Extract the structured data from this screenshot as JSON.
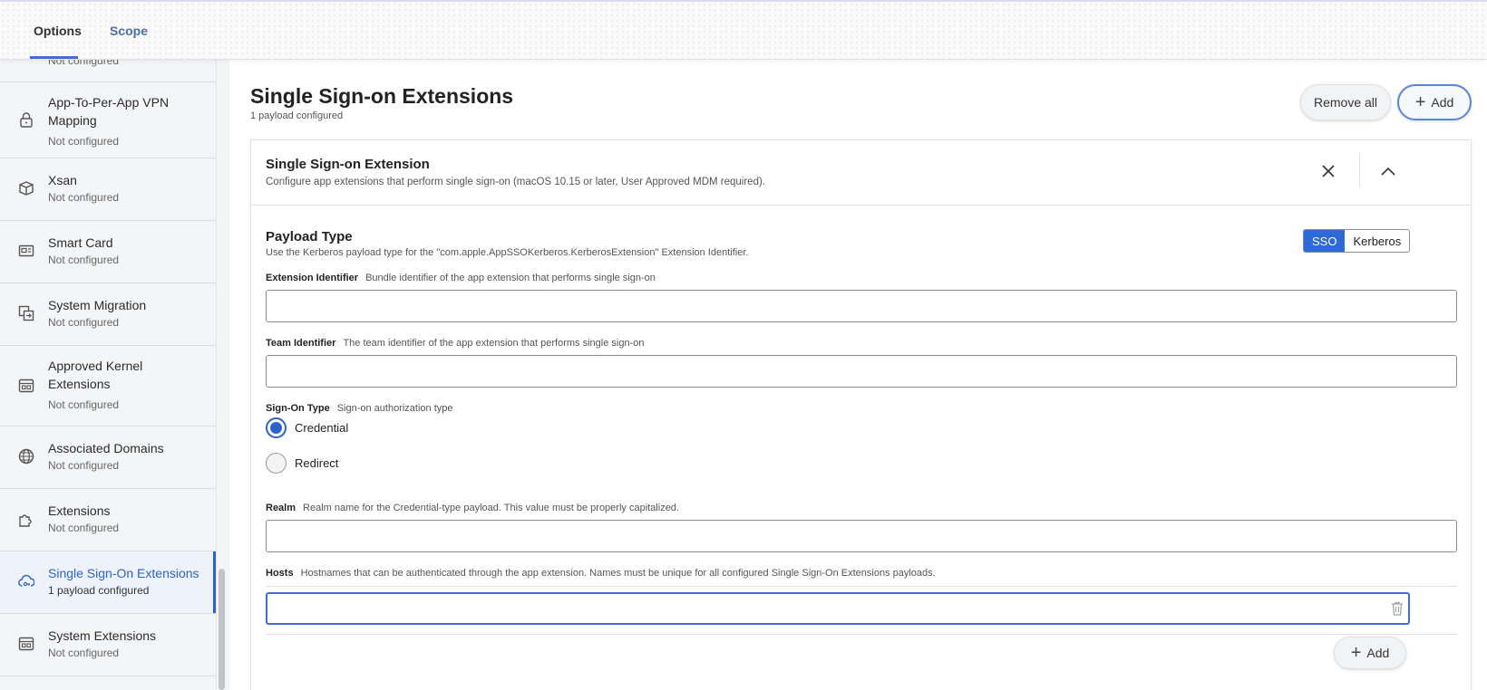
{
  "tabs": {
    "options": "Options",
    "scope": "Scope"
  },
  "sidebar": {
    "partial_item": {
      "sub": "Not configured",
      "icon": "dashes-icon"
    },
    "items": [
      {
        "title": "App-To-Per-App VPN Mapping",
        "sub": "Not configured",
        "icon": "lock-icon"
      },
      {
        "title": "Xsan",
        "sub": "Not configured",
        "icon": "xsan-icon"
      },
      {
        "title": "Smart Card",
        "sub": "Not configured",
        "icon": "smart-card-icon"
      },
      {
        "title": "System Migration",
        "sub": "Not configured",
        "icon": "migration-icon"
      },
      {
        "title": "Approved Kernel Extensions",
        "sub": "Not configured",
        "icon": "kernel-extension-icon"
      },
      {
        "title": "Associated Domains",
        "sub": "Not configured",
        "icon": "globe-icon"
      },
      {
        "title": "Extensions",
        "sub": "Not configured",
        "icon": "puzzle-icon"
      },
      {
        "title": "Single Sign-On Extensions",
        "sub": "1 payload configured",
        "icon": "cloud-key-icon",
        "active": true
      },
      {
        "title": "System Extensions",
        "sub": "Not configured",
        "icon": "system-extension-icon"
      }
    ]
  },
  "main": {
    "title": "Single Sign-on Extensions",
    "subtitle": "1 payload configured",
    "remove_all": "Remove all",
    "add": "Add"
  },
  "card": {
    "title": "Single Sign-on Extension",
    "subtitle": "Configure app extensions that perform single sign-on (macOS 10.15 or later, User Approved MDM required).",
    "payload_type": {
      "title": "Payload Type",
      "desc": "Use the Kerberos payload type for the \"com.apple.AppSSOKerberos.KerberosExtension\" Extension Identifier.",
      "options": [
        "SSO",
        "Kerberos"
      ],
      "selected": "SSO"
    },
    "extension_identifier": {
      "label": "Extension Identifier",
      "help": "Bundle identifier of the app extension that performs single sign-on",
      "value": ""
    },
    "team_identifier": {
      "label": "Team Identifier",
      "help": "The team identifier of the app extension that performs single sign-on",
      "value": ""
    },
    "sign_on_type": {
      "label": "Sign-On Type",
      "help": "Sign-on authorization type",
      "options": [
        "Credential",
        "Redirect"
      ],
      "selected": "Credential"
    },
    "realm": {
      "label": "Realm",
      "help": "Realm name for the Credential-type payload. This value must be properly capitalized.",
      "value": ""
    },
    "hosts": {
      "label": "Hosts",
      "help": "Hostnames that can be authenticated through the app extension. Names must be unique for all configured Single Sign-On Extensions payloads.",
      "value": ""
    },
    "add": "Add"
  },
  "colors": {
    "accent": "#2d63c8",
    "selected_segment": "#2d6ad8"
  }
}
